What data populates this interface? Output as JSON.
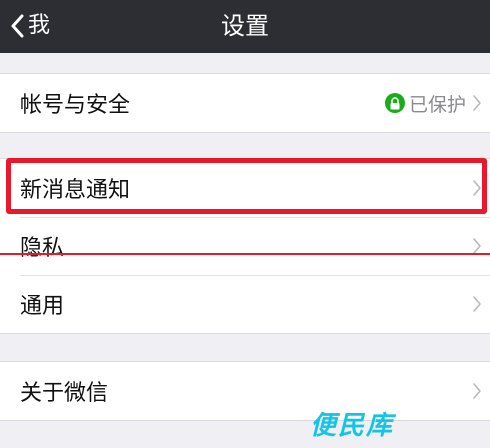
{
  "nav": {
    "back_label": "我",
    "title": "设置"
  },
  "groups": [
    {
      "items": [
        {
          "label": "帐号与安全",
          "status_text": "已保护",
          "status_icon": "lock-icon",
          "status_color": "#1aad19"
        }
      ]
    },
    {
      "items": [
        {
          "label": "新消息通知"
        },
        {
          "label": "隐私"
        },
        {
          "label": "通用"
        }
      ]
    },
    {
      "items": [
        {
          "label": "关于微信"
        }
      ]
    }
  ],
  "watermark": "便民库",
  "colors": {
    "nav_bg": "#2d2e33",
    "page_bg": "#efeff4",
    "highlight": "#e8192c",
    "watermark": "#14c4e8"
  }
}
